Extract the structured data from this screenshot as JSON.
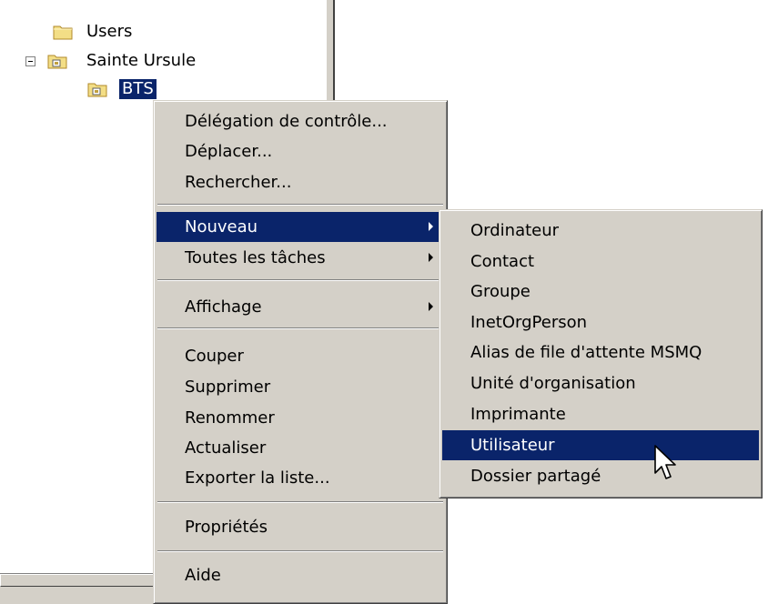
{
  "tree": {
    "nodes": [
      {
        "label": "Users"
      },
      {
        "label": "Sainte Ursule"
      },
      {
        "label": "BTS"
      }
    ]
  },
  "context_menu": {
    "items": [
      {
        "label": "Délégation de contrôle..."
      },
      {
        "label": "Déplacer..."
      },
      {
        "label": "Rechercher..."
      },
      {
        "label": "Nouveau",
        "submenu": true,
        "highlighted": true
      },
      {
        "label": "Toutes les tâches",
        "submenu": true
      },
      {
        "label": "Affichage",
        "submenu": true
      },
      {
        "label": "Couper"
      },
      {
        "label": "Supprimer"
      },
      {
        "label": "Renommer"
      },
      {
        "label": "Actualiser"
      },
      {
        "label": "Exporter la liste..."
      },
      {
        "label": "Propriétés"
      },
      {
        "label": "Aide"
      }
    ]
  },
  "submenu_nouveau": {
    "items": [
      {
        "label": "Ordinateur"
      },
      {
        "label": "Contact"
      },
      {
        "label": "Groupe"
      },
      {
        "label": "InetOrgPerson"
      },
      {
        "label": "Alias de file d'attente MSMQ"
      },
      {
        "label": "Unité d'organisation"
      },
      {
        "label": "Imprimante"
      },
      {
        "label": "Utilisateur",
        "highlighted": true
      },
      {
        "label": "Dossier partagé"
      }
    ]
  },
  "colors": {
    "menu_bg": "#d4d0c8",
    "highlight": "#0a246a",
    "folder": "#e8d06a"
  }
}
